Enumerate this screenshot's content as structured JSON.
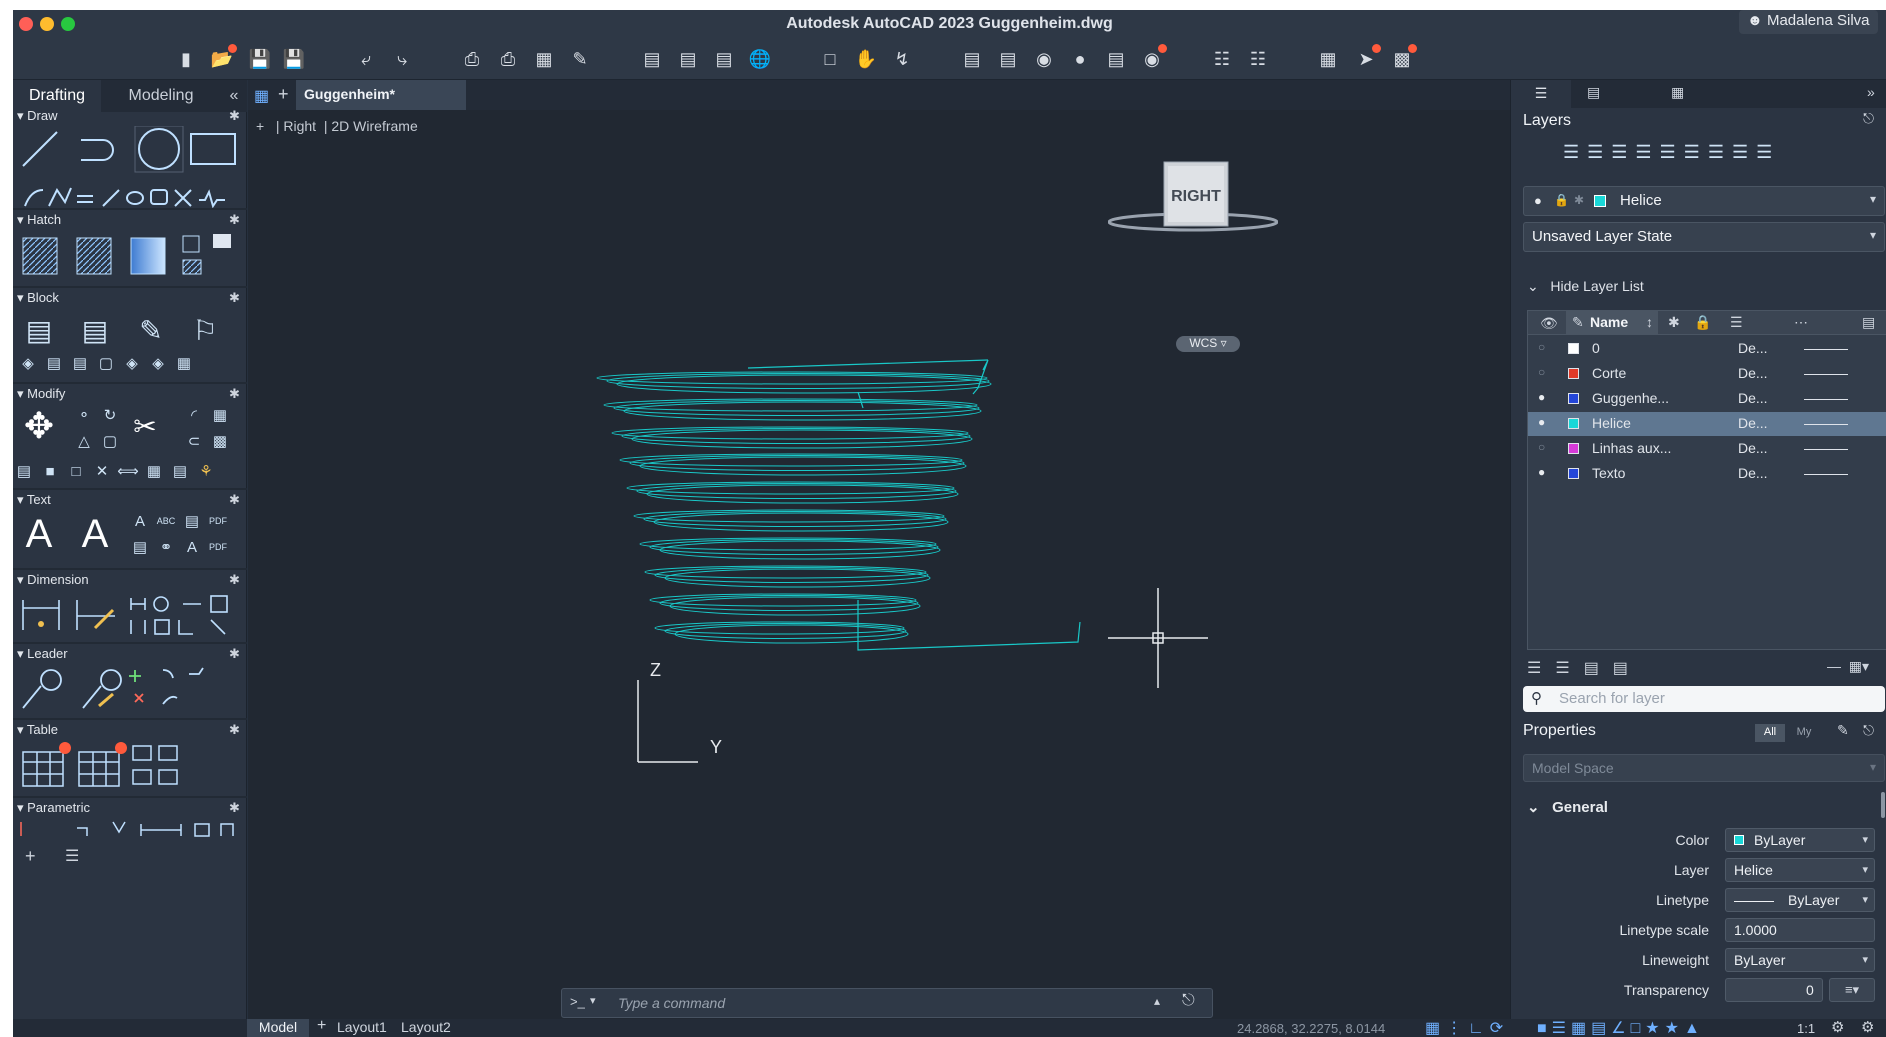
{
  "window": {
    "title": "Autodesk AutoCAD 2023   Guggenheim.dwg",
    "user": "Madalena Silva"
  },
  "workspace_tabs": [
    "Drafting",
    "Modeling"
  ],
  "panels": {
    "draw": "Draw",
    "hatch": "Hatch",
    "block": "Block",
    "modify": "Modify",
    "text": "Text",
    "dimension": "Dimension",
    "leader": "Leader",
    "table": "Table",
    "parametric": "Parametric"
  },
  "document_tab": "Guggenheim*",
  "viewport": {
    "plus": "+",
    "view": "Right",
    "style": "2D Wireframe",
    "viewcube": "RIGHT",
    "wcs": "WCS",
    "ucs_y": "Y",
    "ucs_z": "Z"
  },
  "layers_panel": {
    "title": "Layers",
    "current_layer": "Helice",
    "current_layer_color": "#19d7d7",
    "layer_state": "Unsaved Layer State",
    "hide_list": "Hide Layer List",
    "column_name": "Name",
    "layers": [
      {
        "name": "0",
        "color": "#ffffff",
        "linetype": "De..."
      },
      {
        "name": "Corte",
        "color": "#e03a2a",
        "linetype": "De..."
      },
      {
        "name": "Guggenhe...",
        "color": "#2446d8",
        "linetype": "De..."
      },
      {
        "name": "Helice",
        "color": "#19d7d7",
        "linetype": "De..."
      },
      {
        "name": "Linhas aux...",
        "color": "#d63ad8",
        "linetype": "De..."
      },
      {
        "name": "Texto",
        "color": "#2446d8",
        "linetype": "De..."
      }
    ],
    "selected_index": 3,
    "search_placeholder": "Search for layer"
  },
  "properties": {
    "title": "Properties",
    "filter_all": "All",
    "filter_my": "My",
    "context": "Model Space",
    "group": "General",
    "rows": [
      {
        "label": "Color",
        "value": "ByLayer"
      },
      {
        "label": "Layer",
        "value": "Helice"
      },
      {
        "label": "Linetype",
        "value": "ByLayer"
      },
      {
        "label": "Linetype scale",
        "value": "1.0000"
      },
      {
        "label": "Lineweight",
        "value": "ByLayer"
      },
      {
        "label": "Transparency",
        "value": "0"
      }
    ]
  },
  "command": {
    "prompt": ">_",
    "placeholder": "Type a command"
  },
  "layout_tabs": [
    "Model",
    "Layout1",
    "Layout2"
  ],
  "status": {
    "coordinates": "24.2868, 32.2275, 8.0144",
    "scale": "1:1"
  },
  "colors": {
    "accent": "#1e90ff",
    "helix": "#19c8c8",
    "background": "#212832"
  }
}
